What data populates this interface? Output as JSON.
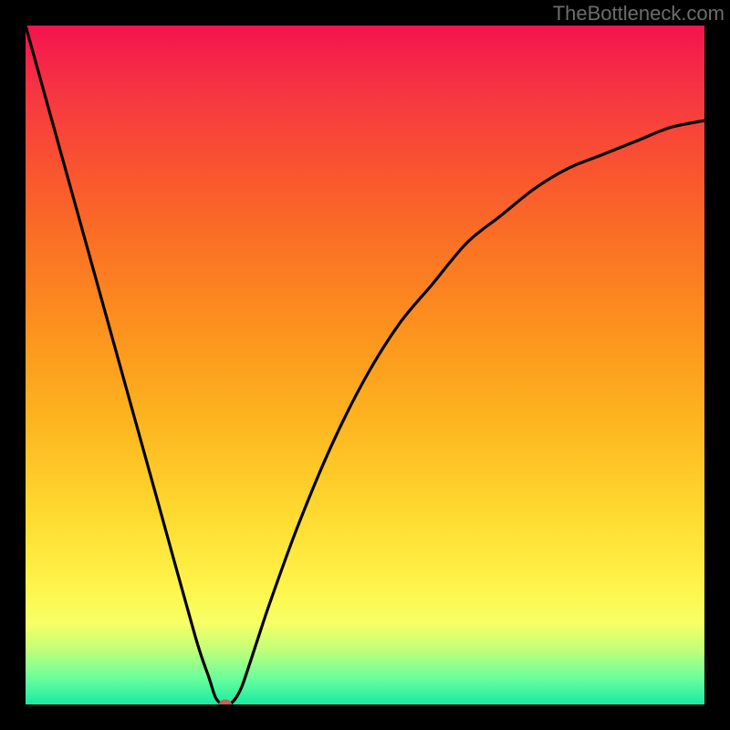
{
  "watermark": {
    "text": "TheBottleneck.com"
  },
  "colors": {
    "frame": "#000000",
    "curve": "#000000",
    "marker": "#cc5b5b",
    "watermark_text": "#6d6d6d"
  },
  "chart_data": {
    "type": "line",
    "title": "",
    "xlabel": "",
    "ylabel": "",
    "xlim": [
      0,
      100
    ],
    "ylim": [
      0,
      100
    ],
    "grid": false,
    "x": [
      0,
      5,
      10,
      15,
      20,
      25,
      27,
      28,
      29,
      30,
      31,
      32,
      34,
      36,
      40,
      45,
      50,
      55,
      60,
      65,
      70,
      75,
      80,
      85,
      90,
      95,
      100
    ],
    "values": [
      100,
      82,
      64,
      46,
      28,
      10,
      4,
      1,
      0,
      0,
      1,
      3,
      9,
      15,
      26,
      38,
      48,
      56,
      62,
      68,
      72,
      76,
      79,
      81,
      83,
      85,
      86
    ],
    "marker": {
      "x": 29.5,
      "y": 0
    },
    "note": "Left branch is linear (slope ≈ -3.6). Right branch is a concave monotone curve approaching ~86."
  }
}
